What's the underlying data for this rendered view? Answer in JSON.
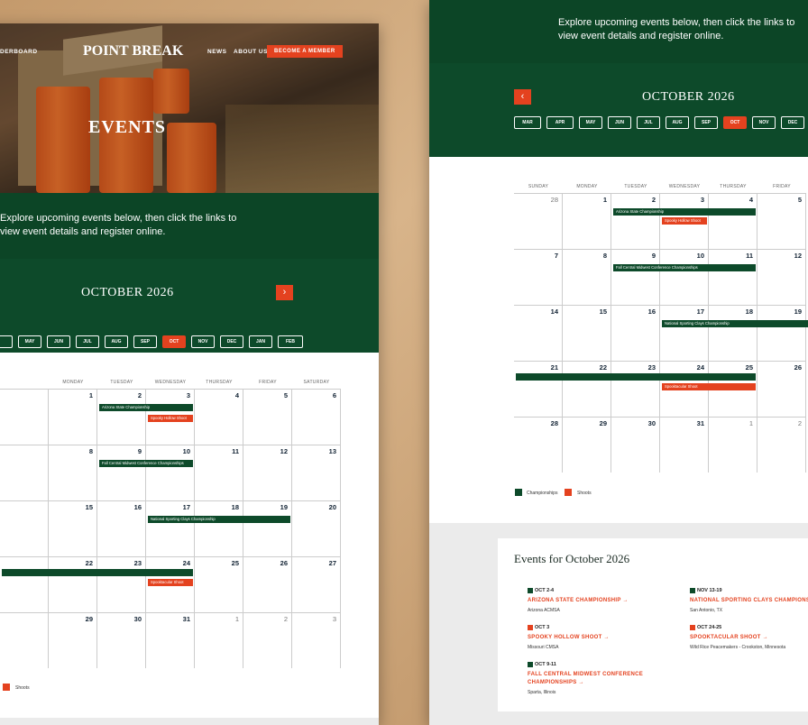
{
  "nav": {
    "left_link": "DERBOARD",
    "logo": "POINT BREAK",
    "links": [
      "NEWS",
      "ABOUT US"
    ],
    "cta": "BECOME A MEMBER"
  },
  "hero": {
    "title": "EVENTS"
  },
  "intro": {
    "line1": "Explore upcoming events below, then click the links to",
    "line2": "view event details and register online.",
    "right_line1": "Explore upcoming events below, then click the links to",
    "right_line2": "view event details and register online."
  },
  "calendar": {
    "month_label": "OCTOBER 2026",
    "left_months": [
      "",
      "MAY",
      "JUN",
      "JUL",
      "AUG",
      "SEP",
      "OCT",
      "NOV",
      "DEC",
      "JAN",
      "FEB"
    ],
    "right_months": [
      "MAR",
      "APR",
      "MAY",
      "JUN",
      "JUL",
      "AUG",
      "SEP",
      "OCT",
      "NOV",
      "DEC",
      ""
    ],
    "selected_month": "OCT",
    "left_days": [
      "",
      "MONDAY",
      "TUESDAY",
      "WEDNESDAY",
      "THURSDAY",
      "FRIDAY",
      "SATURDAY"
    ],
    "right_days": [
      "SUNDAY",
      "MONDAY",
      "TUESDAY",
      "WEDNESDAY",
      "THURSDAY",
      "FRIDAY"
    ],
    "left_rows": [
      [
        "",
        "1",
        "2",
        "3",
        "4",
        "5",
        "6"
      ],
      [
        "",
        "8",
        "9",
        "10",
        "11",
        "12",
        "13"
      ],
      [
        "",
        "15",
        "16",
        "17",
        "18",
        "19",
        "20"
      ],
      [
        "",
        "22",
        "23",
        "24",
        "25",
        "26",
        "27"
      ],
      [
        "",
        "29",
        "30",
        "31",
        "1",
        "2",
        "3"
      ]
    ],
    "right_rows": [
      [
        "28",
        "1",
        "2",
        "3",
        "4",
        "5"
      ],
      [
        "7",
        "8",
        "9",
        "10",
        "11",
        "12"
      ],
      [
        "14",
        "15",
        "16",
        "17",
        "18",
        "19"
      ],
      [
        "21",
        "22",
        "23",
        "24",
        "25",
        "26"
      ],
      [
        "28",
        "29",
        "30",
        "31",
        "1",
        "2"
      ]
    ],
    "events": {
      "azs": "Arizona State Championship",
      "spooky": "Spooky Hollow Shoot",
      "fall": "Fall Central Midwest Conference Championships",
      "nscc": "National Sporting Clays Championship",
      "spook2": "Spooktacular Shoot"
    }
  },
  "legend": {
    "championships": "Championships",
    "shoots": "Shoots"
  },
  "events_list": {
    "heading": "Events for October 2026",
    "items": [
      {
        "date": "OCT 2-4",
        "title": "ARIZONA STATE CHAMPIONSHIP →",
        "location": "Arizona ACMSA",
        "type": "championship"
      },
      {
        "date": "OCT 3",
        "title": "SPOOKY HOLLOW SHOOT →",
        "location": "Missouri CMSA",
        "type": "shoot"
      },
      {
        "date": "OCT 9-11",
        "title": "FALL CENTRAL MIDWEST CONFERENCE",
        "title2": "CHAMPIONSHIPS →",
        "location": "Sparta, Illinois",
        "type": "championship"
      },
      {
        "date": "NOV 13-19",
        "title": "NATIONAL SPORTING CLAYS CHAMPIONSHIP",
        "location": "San Antonio, TX",
        "type": "championship"
      },
      {
        "date": "OCT 24-25",
        "title": "SPOOKTACULAR SHOOT →",
        "location": "Wild Rice Peacemakers - Crookston, Minnesota",
        "type": "shoot"
      }
    ]
  },
  "colors": {
    "green": "#0d4a2a",
    "orange": "#e4421f"
  }
}
